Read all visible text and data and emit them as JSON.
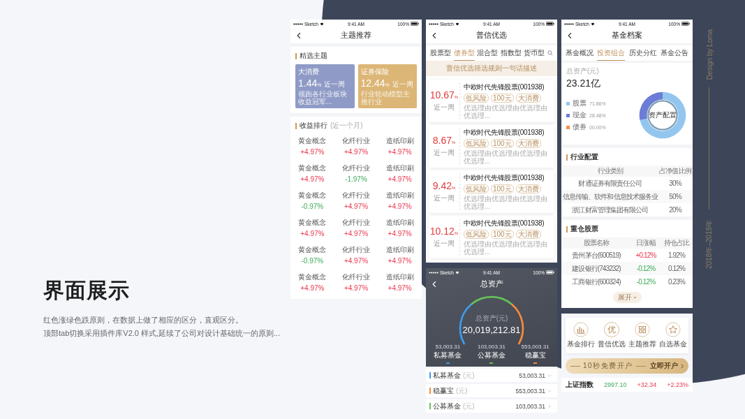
{
  "heading": "界面展示",
  "description": [
    "红色涨绿色跌原则，在数据上做了相应的区分，直观区分。",
    "顶部tab切换采用插件库V2.0 样式,延续了公司对设计基础统一的原则..."
  ],
  "credit": {
    "author": "Design by Loma",
    "years": "2018年–2019年"
  },
  "screens": [
    {
      "kind": "themes",
      "status_bar": {
        "carrier": "Sketch",
        "time": "9:41 AM",
        "battery": "100%"
      },
      "title": "主题推荐",
      "featured": {
        "title": "精选主题",
        "items": [
          {
            "name": "大消费",
            "value": "1.44",
            "unit": "%",
            "period": "近一周",
            "desc": "领跑各行业板块收益冠军...",
            "color": "#8f9bc6"
          },
          {
            "name": "证券保险",
            "value": "12.44",
            "unit": "%",
            "period": "近一周",
            "desc": "行业轮动模型主推行业",
            "color": "#dcb676"
          }
        ]
      },
      "ranking": {
        "title": "收益排行",
        "note": "(近一个月)",
        "rows": [
          {
            "cells": [
              {
                "name": "黄金概念",
                "change": "+4.97%",
                "rising": true
              },
              {
                "name": "化纤行业",
                "change": "+4.97%",
                "rising": true
              },
              {
                "name": "造纸印刷",
                "change": "+4.97%",
                "rising": true
              }
            ]
          },
          {
            "cells": [
              {
                "name": "黄金概念",
                "change": "+4.97%",
                "rising": true
              },
              {
                "name": "化纤行业",
                "change": "-1.97%",
                "rising": false
              },
              {
                "name": "造纸印刷",
                "change": "+4.97%",
                "rising": true
              }
            ]
          },
          {
            "cells": [
              {
                "name": "黄金概念",
                "change": "-0.97%",
                "rising": false
              },
              {
                "name": "化纤行业",
                "change": "+4.97%",
                "rising": true
              },
              {
                "name": "造纸印刷",
                "change": "+4.97%",
                "rising": true
              }
            ]
          },
          {
            "cells": [
              {
                "name": "黄金概念",
                "change": "+4.97%",
                "rising": true
              },
              {
                "name": "化纤行业",
                "change": "+4.97%",
                "rising": true
              },
              {
                "name": "造纸印刷",
                "change": "+4.97%",
                "rising": true
              }
            ]
          },
          {
            "cells": [
              {
                "name": "黄金概念",
                "change": "-0.97%",
                "rising": false
              },
              {
                "name": "化纤行业",
                "change": "+4.97%",
                "rising": true
              },
              {
                "name": "造纸印刷",
                "change": "+4.97%",
                "rising": true
              }
            ]
          },
          {
            "cells": [
              {
                "name": "黄金概念",
                "change": "+4.97%",
                "rising": true
              },
              {
                "name": "化纤行业",
                "change": "+4.97%",
                "rising": true
              },
              {
                "name": "造纸印刷",
                "change": "+4.97%",
                "rising": true
              }
            ]
          }
        ]
      }
    },
    {
      "kind": "picks",
      "status_bar": {
        "carrier": "Sketch",
        "time": "9:41 AM",
        "battery": "100%"
      },
      "title": "普信优选",
      "tabs": [
        {
          "label": "股票型",
          "selected": false
        },
        {
          "label": "债券型",
          "selected": true
        },
        {
          "label": "混合型",
          "selected": false
        },
        {
          "label": "指数型",
          "selected": false
        },
        {
          "label": "货币型",
          "selected": false
        }
      ],
      "notice": "普信优选筛选规则一句话描述",
      "funds": [
        {
          "rate": "10.67",
          "unit": "%",
          "period": "近一周",
          "name": "中欧时代先锋股票(001938)",
          "tags": [
            "低风险",
            "100元",
            "大消费"
          ],
          "reason": "优选理由优选理由优选理由优选理..."
        },
        {
          "rate": "8.67",
          "unit": "%",
          "period": "近一周",
          "name": "中欧时代先锋股票(001938)",
          "tags": [
            "低风险",
            "100元",
            "大消费"
          ],
          "reason": "优选理由优选理由优选理由优选理..."
        },
        {
          "rate": "9.42",
          "unit": "%",
          "period": "近一周",
          "name": "中欧时代先锋股票(001938)",
          "tags": [
            "低风险",
            "100元",
            "大消费"
          ],
          "reason": "优选理由优选理由优选理由优选理..."
        },
        {
          "rate": "10.12",
          "unit": "%",
          "period": "近一周",
          "name": "中欧时代先锋股票(001938)",
          "tags": [
            "低风险",
            "100元",
            "大消费"
          ],
          "reason": "优选理由优选理由优选理由优选理..."
        }
      ]
    },
    {
      "kind": "assets",
      "status_bar": {
        "carrier": "Sketch",
        "time": "9:41 AM",
        "battery": "100%"
      },
      "title": "总资产",
      "total_label": "总资产(元)",
      "total": "20,019,212.81",
      "parts": [
        {
          "value": "53,003.31",
          "name": "私募基金",
          "color": "#3b9cf2"
        },
        {
          "value": "103,003.31",
          "name": "公募基金",
          "color": "#66c15a"
        },
        {
          "value": "553,003.31",
          "name": "稳赢宝",
          "color": "#f68b3a"
        }
      ],
      "accounts": [
        {
          "name": "私募基金",
          "unit": "(元)",
          "value": "53,003.31",
          "color": "#3b9cf2",
          "kind": "dropdown"
        },
        {
          "name": "稳赢宝",
          "unit": "(元)",
          "value": "553,003.31",
          "color": "#f68b3a",
          "kind": "dropdown"
        },
        {
          "name": "公募基金",
          "unit": "(元)",
          "value": "103,003.31",
          "color": "#66c15a",
          "kind": "link"
        }
      ]
    },
    {
      "kind": "profile",
      "status_bar": {
        "carrier": "Sketch",
        "time": "9:41 AM",
        "battery": "100%"
      },
      "title": "基金档案",
      "tabs": [
        {
          "label": "基金概况",
          "selected": false
        },
        {
          "label": "投资组合",
          "selected": true
        },
        {
          "label": "历史分红",
          "selected": false
        },
        {
          "label": "基金公告",
          "selected": false
        }
      ],
      "total_label": "总资产(元)",
      "total": "23.21亿",
      "allocation": [
        {
          "share": "71.86%",
          "color": "#93c6ef"
        },
        {
          "share": "28.48%",
          "color": "#6b7dd6"
        },
        {
          "share": "00.00%",
          "color": "#f59048"
        }
      ],
      "chart_data": {
        "type": "donut",
        "title": "资产配置",
        "categories": [
          "股票",
          "现金",
          "债券"
        ],
        "values": [
          71.86,
          28.48,
          0
        ]
      },
      "industry": {
        "title": "行业配置",
        "columns": [
          "行业类别",
          "占净值比例"
        ],
        "rows": [
          [
            "财通证券有限责任公司",
            "30%"
          ],
          [
            "信息传输、软件和信息技术服务业",
            "50%"
          ],
          [
            "浙江财富管理集团有限公司",
            "20%"
          ]
        ]
      },
      "holdings": {
        "title": "重仓股票",
        "columns": [
          "股票名称",
          "日涨幅",
          "持仓占比"
        ],
        "rows": [
          {
            "name": "贵州茅台(600519)",
            "change": "+0.12%",
            "rising": true,
            "share": "1.92%"
          },
          {
            "name": "建设银行(743232)",
            "change": "-0.12%",
            "rising": false,
            "share": "0.12%"
          },
          {
            "name": "工商银行(600324)",
            "change": "-0.12%",
            "rising": false,
            "share": "0.23%"
          }
        ],
        "expand": "展开"
      }
    },
    {
      "kind": "home",
      "shortcuts": [
        {
          "kind": "bars",
          "label": "基金排行"
        },
        {
          "kind": "glyph",
          "glyph": "优",
          "label": "普信优选"
        },
        {
          "kind": "grid",
          "label": "主题推荐"
        },
        {
          "kind": "star",
          "label": "自选基金"
        }
      ],
      "promo": {
        "text": "10秒免费开户",
        "action": "立即开户"
      },
      "index": {
        "name": "上证指数",
        "cells": [
          {
            "text": "2997.10",
            "rising": false
          },
          {
            "text": "+32.34",
            "rising": true
          },
          {
            "text": "+2.23%",
            "rising": true
          }
        ]
      }
    }
  ]
}
